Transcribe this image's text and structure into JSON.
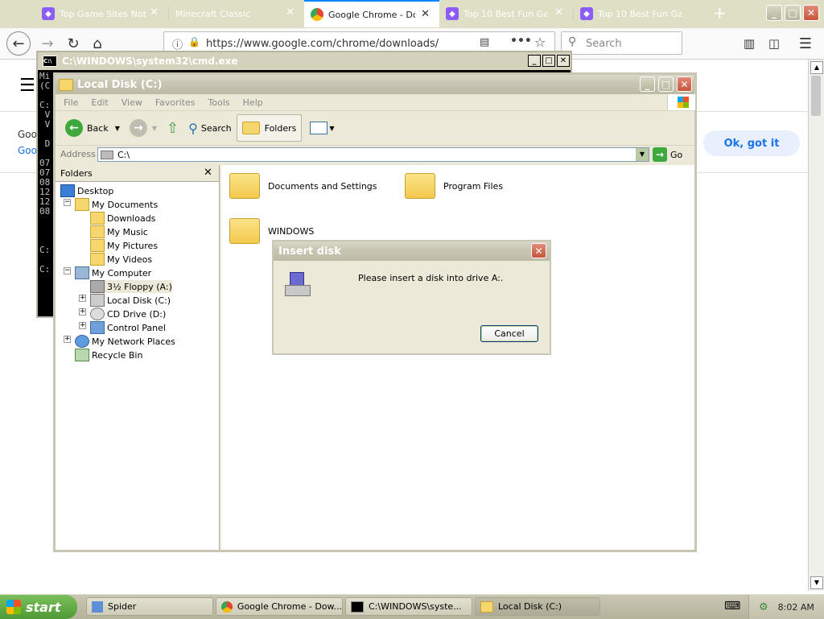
{
  "browser": {
    "tabs": [
      {
        "title": "Top Game Sites Not L",
        "favicon": "game-site-icon",
        "active": false
      },
      {
        "title": "Minecraft Classic",
        "favicon": "none",
        "active": false
      },
      {
        "title": "Google Chrome - Dow",
        "favicon": "chrome-icon",
        "active": true
      },
      {
        "title": "Top 10 Best Fun Gam",
        "favicon": "game-site-icon",
        "active": false
      },
      {
        "title": "Top 10 Best Fun Gam",
        "favicon": "game-site-icon",
        "active": false
      }
    ],
    "url": "https://www.google.com/chrome/downloads/",
    "search_placeholder": "Search",
    "page": {
      "ok_button": "Ok, got it",
      "text_line1": "Goo",
      "text_line2": "Goo"
    }
  },
  "cmd": {
    "title": "C:\\WINDOWS\\system32\\cmd.exe",
    "lines": [
      "Mi",
      "(C",
      "",
      "C:",
      " V",
      " V",
      "",
      " D",
      "",
      "07",
      "07",
      "08",
      "12",
      "12",
      "08",
      "",
      "",
      "",
      "C:",
      "",
      "C:"
    ]
  },
  "explorer": {
    "title": "Local Disk (C:)",
    "menu": [
      "File",
      "Edit",
      "View",
      "Favorites",
      "Tools",
      "Help"
    ],
    "toolbar": {
      "back": "Back",
      "search": "Search",
      "folders": "Folders"
    },
    "address_label": "Address",
    "address_value": "C:\\",
    "go_label": "Go",
    "folders_header": "Folders",
    "tree": {
      "desktop": "Desktop",
      "my_documents": "My Documents",
      "downloads": "Downloads",
      "my_music": "My Music",
      "my_pictures": "My Pictures",
      "my_videos": "My Videos",
      "my_computer": "My Computer",
      "floppy": "3½ Floppy (A:)",
      "local_disk": "Local Disk (C:)",
      "cd_drive": "CD Drive (D:)",
      "control_panel": "Control Panel",
      "network": "My Network Places",
      "recycle": "Recycle Bin"
    },
    "folders": [
      "Documents and Settings",
      "Program Files",
      "WINDOWS"
    ]
  },
  "dialog": {
    "title": "Insert disk",
    "message": "Please insert a disk into drive A:.",
    "cancel": "Cancel"
  },
  "taskbar": {
    "start": "start",
    "buttons": [
      "Spider",
      "Google Chrome - Dow...",
      "C:\\WINDOWS\\syste...",
      "Local Disk (C:)"
    ],
    "clock": "8:02 AM"
  },
  "colors": {
    "firefox_accent": "#0a84ff",
    "xp_title": "#c9c7b3",
    "start_green": "#4d9a36"
  }
}
